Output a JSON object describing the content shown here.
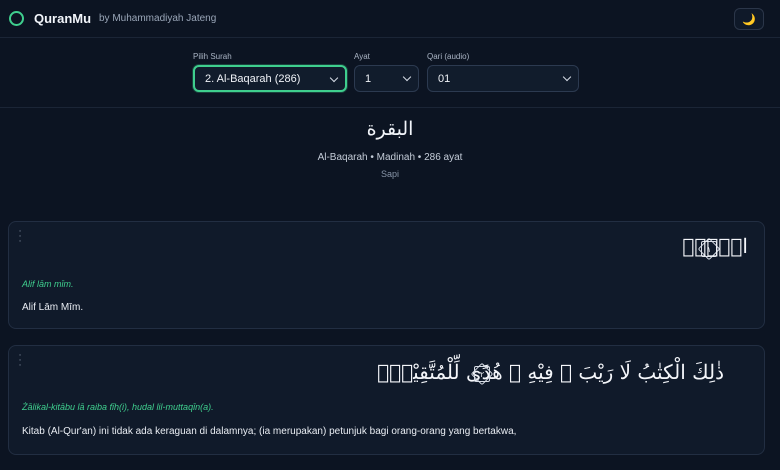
{
  "header": {
    "brand": "QuranMu",
    "byline": "by Muhammadiyah Jateng",
    "theme_icon": "moon-icon",
    "theme_glyph": "🌙"
  },
  "controls": {
    "surah_label": "Pilih Surah",
    "surah_value": "2. Al-Baqarah (286)",
    "ayat_label": "Ayat",
    "ayat_value": "1",
    "qari_label": "Qari (audio)",
    "qari_value": "01"
  },
  "surah": {
    "arabic": "البقرة",
    "meta": "Al-Baqarah • Madinah • 286 ayat",
    "meaning": "Sapi"
  },
  "ayahs": [
    {
      "number": "١",
      "arabic": "الۤمّۤ",
      "transliteration": "Alif lām mīm.",
      "translation": "Alif Lām Mīm."
    },
    {
      "number": "٢",
      "arabic": "ذٰلِكَ الْكِتٰبُ لَا رَيْبَ ۛ فِيْهِ ۛ هُدًى لِّلْمُتَّقِيْنَۙ",
      "transliteration": "Żālikal-kitābu lā raiba fīh(i), hudal lil-muttaqīn(a).",
      "translation": "Kitab (Al-Qur'an) ini tidak ada keraguan di dalamnya; (ia merupakan) petunjuk bagi orang-orang yang bertakwa,"
    }
  ],
  "colors": {
    "background": "#0c1422",
    "accent": "#3fcf8e",
    "card": "#101a2a"
  }
}
